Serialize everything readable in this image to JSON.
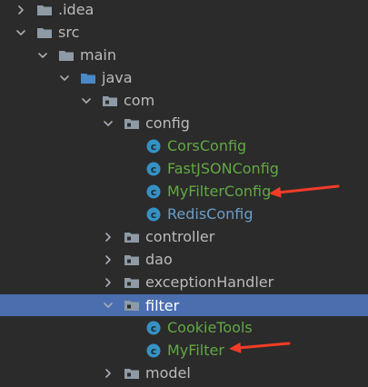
{
  "project_tree": {
    "nodes": [
      {
        "id": "idea",
        "label": ".idea",
        "kind": "folder",
        "expanded": false,
        "depth": 0
      },
      {
        "id": "src",
        "label": "src",
        "kind": "folder",
        "expanded": true,
        "depth": 0
      },
      {
        "id": "main",
        "label": "main",
        "kind": "folder",
        "expanded": true,
        "depth": 1
      },
      {
        "id": "java",
        "label": "java",
        "kind": "source-folder",
        "expanded": true,
        "depth": 2
      },
      {
        "id": "com",
        "label": "com",
        "kind": "package",
        "expanded": true,
        "depth": 3
      },
      {
        "id": "config",
        "label": "config",
        "kind": "package",
        "expanded": true,
        "depth": 4
      },
      {
        "id": "corsconfig",
        "label": "CorsConfig",
        "kind": "class",
        "depth": 5,
        "status": "added"
      },
      {
        "id": "fastjsonconfig",
        "label": "FastJSONConfig",
        "kind": "class",
        "depth": 5,
        "status": "added"
      },
      {
        "id": "myfilterconfig",
        "label": "MyFilterConfig",
        "kind": "class",
        "depth": 5,
        "status": "added",
        "annotated": true
      },
      {
        "id": "redisconfig",
        "label": "RedisConfig",
        "kind": "class",
        "depth": 5,
        "status": "modified"
      },
      {
        "id": "controller",
        "label": "controller",
        "kind": "package",
        "expanded": false,
        "depth": 4
      },
      {
        "id": "dao",
        "label": "dao",
        "kind": "package",
        "expanded": false,
        "depth": 4
      },
      {
        "id": "exceptionhandler",
        "label": "exceptionHandler",
        "kind": "package",
        "expanded": false,
        "depth": 4
      },
      {
        "id": "filter",
        "label": "filter",
        "kind": "package",
        "expanded": true,
        "depth": 4,
        "selected": true
      },
      {
        "id": "cookietools",
        "label": "CookieTools",
        "kind": "class",
        "depth": 5,
        "status": "added"
      },
      {
        "id": "myfilter",
        "label": "MyFilter",
        "kind": "class",
        "depth": 5,
        "status": "added",
        "annotated": true
      },
      {
        "id": "model",
        "label": "model",
        "kind": "package",
        "expanded": false,
        "depth": 4
      }
    ]
  },
  "colors": {
    "background": "#2b2b2b",
    "selection": "#4b6eaf",
    "added_file_text": "#62a844",
    "modified_file_text": "#6a9ec9",
    "default_text": "#bbbbbb",
    "folder_icon": "#8e9ba6",
    "source_folder_icon": "#4a88c7",
    "class_icon": "#3592c4",
    "annotation_arrow": "#f23c27"
  },
  "icons": {
    "collapsed": "chevron-right-icon",
    "expanded": "chevron-down-icon",
    "folder": "folder-icon",
    "source_folder": "source-folder-icon",
    "package": "package-icon",
    "class": "java-class-icon"
  }
}
